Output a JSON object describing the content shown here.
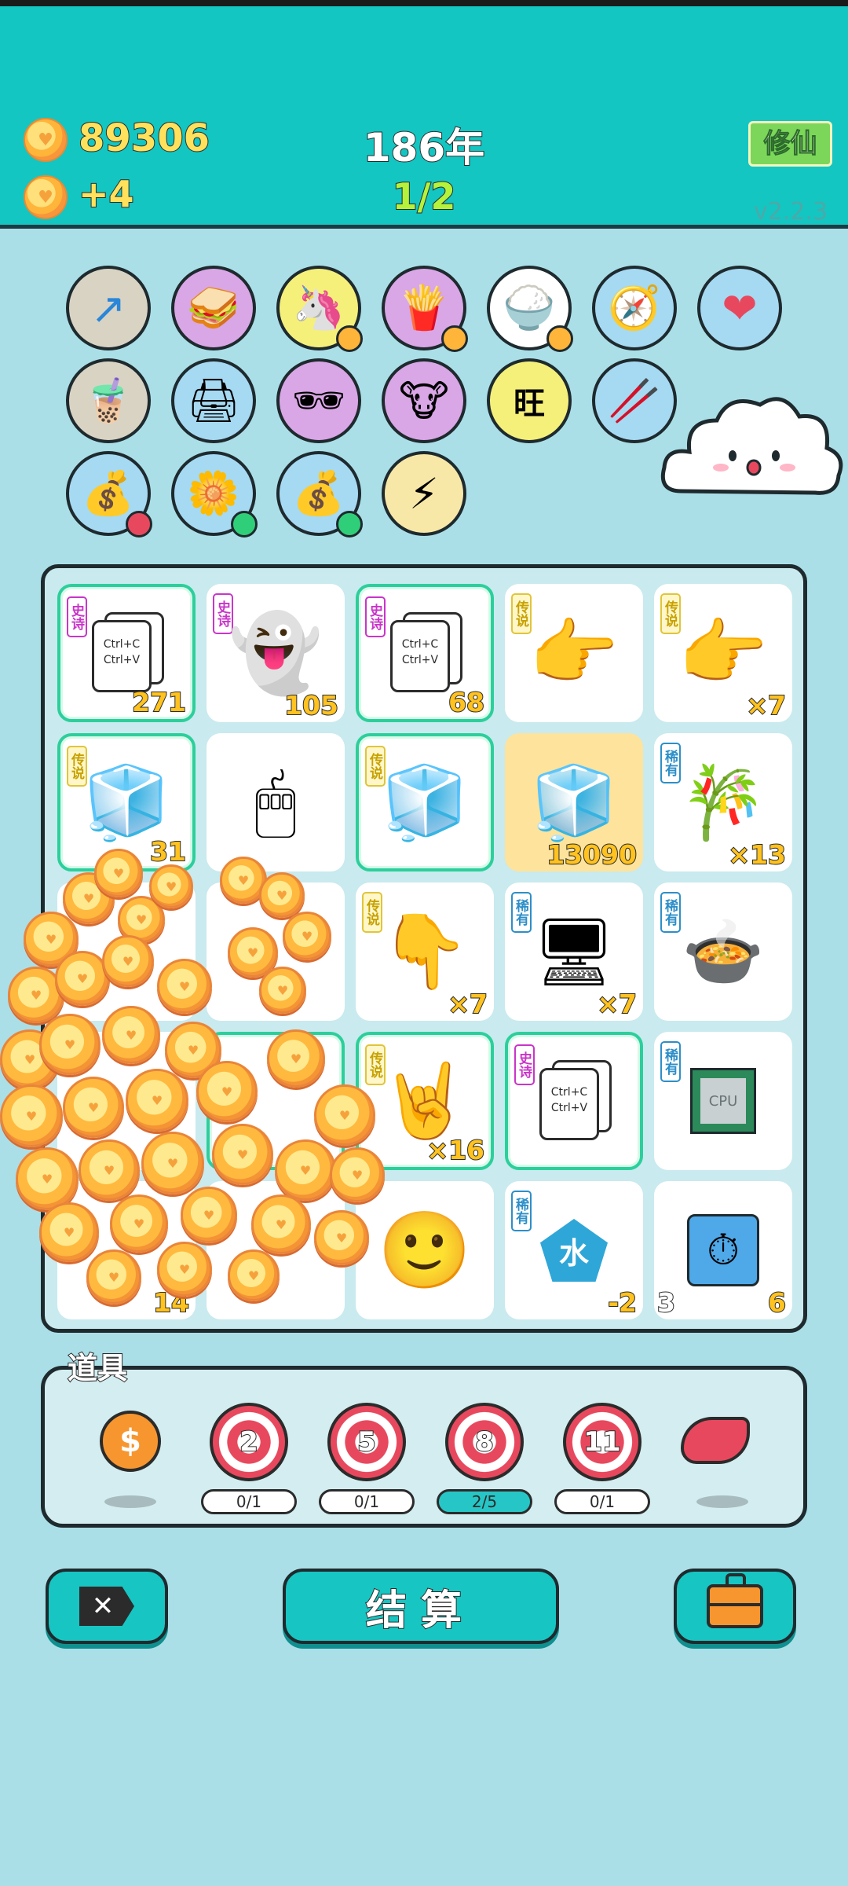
{
  "header": {
    "coins": "89306",
    "coin_gain": "+4",
    "year": "186年",
    "round_progress": "1/2",
    "cultivate_label": "修仙",
    "version": "v2.2.3"
  },
  "relics": [
    {
      "icon": "arrow-up-right-icon",
      "glyph": "↗",
      "color": "#d9d3c4"
    },
    {
      "icon": "toaster-icon",
      "glyph": "🥪",
      "color": "#d9a6e6"
    },
    {
      "icon": "unicorn-icon",
      "glyph": "🦄",
      "color": "#f5f07a"
    },
    {
      "icon": "fries-icon",
      "glyph": "🍟",
      "color": "#d9a6e6"
    },
    {
      "icon": "rice-bowl-icon",
      "glyph": "🍚",
      "color": "#ffffff"
    },
    {
      "icon": "compass-icon",
      "glyph": "🧭",
      "color": "#a6d9f2"
    },
    {
      "icon": "heart-balloon-icon",
      "glyph": "❤",
      "color": "#a6d9f2"
    },
    {
      "icon": "bubble-tea-icon",
      "glyph": "🧋",
      "color": "#d9d3c4"
    },
    {
      "icon": "printer-icon",
      "glyph": "🖨",
      "color": "#a6d9f2"
    },
    {
      "icon": "sunglasses-egg-icon",
      "glyph": "🕶",
      "color": "#d9a6e6"
    },
    {
      "icon": "cow-tv-icon",
      "glyph": "🐮",
      "color": "#d9a6e6"
    },
    {
      "icon": "wang-tiles-icon",
      "glyph": "旺",
      "color": "#f5f07a"
    },
    {
      "icon": "chopsticks-icon",
      "glyph": "🥢",
      "color": "#a6d9f2"
    },
    {
      "icon": "money-bag-red-icon",
      "glyph": "💰",
      "color": "#a6d9f2"
    },
    {
      "icon": "flower-pot-icon",
      "glyph": "🌼",
      "color": "#a6d9f2"
    },
    {
      "icon": "money-bag-green-icon",
      "glyph": "💰",
      "color": "#a6d9f2"
    },
    {
      "icon": "lightning-icon",
      "glyph": "⚡",
      "color": "#f7e8a8"
    }
  ],
  "board": [
    {
      "rarity": "史诗",
      "tier": "epic",
      "icon": "copy-paste-icon",
      "text": [
        "Ctrl+C",
        "Ctrl+V"
      ],
      "count": "271",
      "highlight": true
    },
    {
      "rarity": "史诗",
      "tier": "epic",
      "icon": "ghost-icon",
      "glyph": "👻",
      "count": "105"
    },
    {
      "rarity": "史诗",
      "tier": "epic",
      "icon": "copy-paste-icon",
      "text": [
        "Ctrl+C",
        "Ctrl+V"
      ],
      "count": "68",
      "highlight": true
    },
    {
      "rarity": "传说",
      "tier": "legend",
      "icon": "pointing-hand-icon",
      "glyph": "👉",
      "count": ""
    },
    {
      "rarity": "传说",
      "tier": "legend",
      "icon": "pointing-hand-icon",
      "glyph": "👉",
      "count": "×7"
    },
    {
      "rarity": "传说",
      "tier": "legend",
      "icon": "fridge-icon",
      "glyph": "🧊",
      "count": "31",
      "highlight": true
    },
    {
      "rarity": "",
      "tier": "",
      "icon": "mouse-icon",
      "glyph": "🖱",
      "count": ""
    },
    {
      "rarity": "传说",
      "tier": "legend",
      "icon": "fridge-icon",
      "glyph": "🧊",
      "count": "",
      "highlight": true
    },
    {
      "rarity": "",
      "tier": "",
      "icon": "fridge-icon",
      "glyph": "🧊",
      "count": "13090",
      "gold": true
    },
    {
      "rarity": "稀有",
      "tier": "rare",
      "icon": "bamboo-icon",
      "glyph": "🎋",
      "count": "×13"
    },
    {
      "rarity": "",
      "tier": "",
      "icon": "coin-pile-icon",
      "glyph": "",
      "count": ""
    },
    {
      "rarity": "",
      "tier": "",
      "icon": "coin-pile-icon",
      "glyph": "",
      "count": ""
    },
    {
      "rarity": "传说",
      "tier": "legend",
      "icon": "pointing-hand-down-icon",
      "glyph": "👇",
      "count": "×7"
    },
    {
      "rarity": "稀有",
      "tier": "rare",
      "icon": "pc-tower-icon",
      "glyph": "🖥",
      "count": "×7"
    },
    {
      "rarity": "稀有",
      "tier": "rare",
      "icon": "pressure-cooker-icon",
      "glyph": "🍲",
      "count": ""
    },
    {
      "rarity": "",
      "tier": "",
      "icon": "coin-pile-icon",
      "glyph": "",
      "count": ""
    },
    {
      "rarity": "",
      "tier": "",
      "icon": "coin-pile-icon",
      "glyph": "",
      "count": "",
      "highlight": true
    },
    {
      "rarity": "传说",
      "tier": "legend",
      "icon": "rock-hand-icon",
      "glyph": "🤘",
      "count": "×16",
      "highlight": true
    },
    {
      "rarity": "史诗",
      "tier": "epic",
      "icon": "copy-paste-icon",
      "text": [
        "Ctrl+C",
        "Ctrl+V"
      ],
      "count": "",
      "highlight": true
    },
    {
      "rarity": "稀有",
      "tier": "rare",
      "icon": "cpu-chip-icon",
      "glyph": "CPU",
      "count": ""
    },
    {
      "rarity": "",
      "tier": "",
      "icon": "coin-pile-icon",
      "glyph": "",
      "count": "14"
    },
    {
      "rarity": "",
      "tier": "",
      "icon": "coin-pile-icon",
      "glyph": "",
      "count": ""
    },
    {
      "rarity": "",
      "tier": "",
      "icon": "smiling-face-icon",
      "glyph": "🙂",
      "count": ""
    },
    {
      "rarity": "稀有",
      "tier": "rare",
      "icon": "water-gem-icon",
      "glyph": "水",
      "count": "-2"
    },
    {
      "rarity": "",
      "tier": "",
      "icon": "stopwatch-icon",
      "glyph": "⏱",
      "count": "6",
      "count_left": "3"
    }
  ],
  "tools": {
    "title": "道具",
    "items": [
      {
        "icon": "dollar-coin-icon",
        "label": "$",
        "bar": ""
      },
      {
        "icon": "target-icon",
        "label": "2",
        "bar": "0/1"
      },
      {
        "icon": "target-icon",
        "label": "5",
        "bar": "0/1"
      },
      {
        "icon": "target-icon",
        "label": "8",
        "bar": "2/5",
        "active": true
      },
      {
        "icon": "target-icon",
        "label": "11",
        "bar": "0/1"
      },
      {
        "icon": "liver-icon",
        "label": "",
        "bar": ""
      }
    ]
  },
  "actions": {
    "close_icon": "close-x-icon",
    "settle_label": "结算",
    "bag_icon": "briefcase-icon"
  },
  "colors": {
    "header": "#13c6c2",
    "background": "#a9dde6",
    "board": "#c9eaee",
    "accent": "#17c5c2"
  }
}
